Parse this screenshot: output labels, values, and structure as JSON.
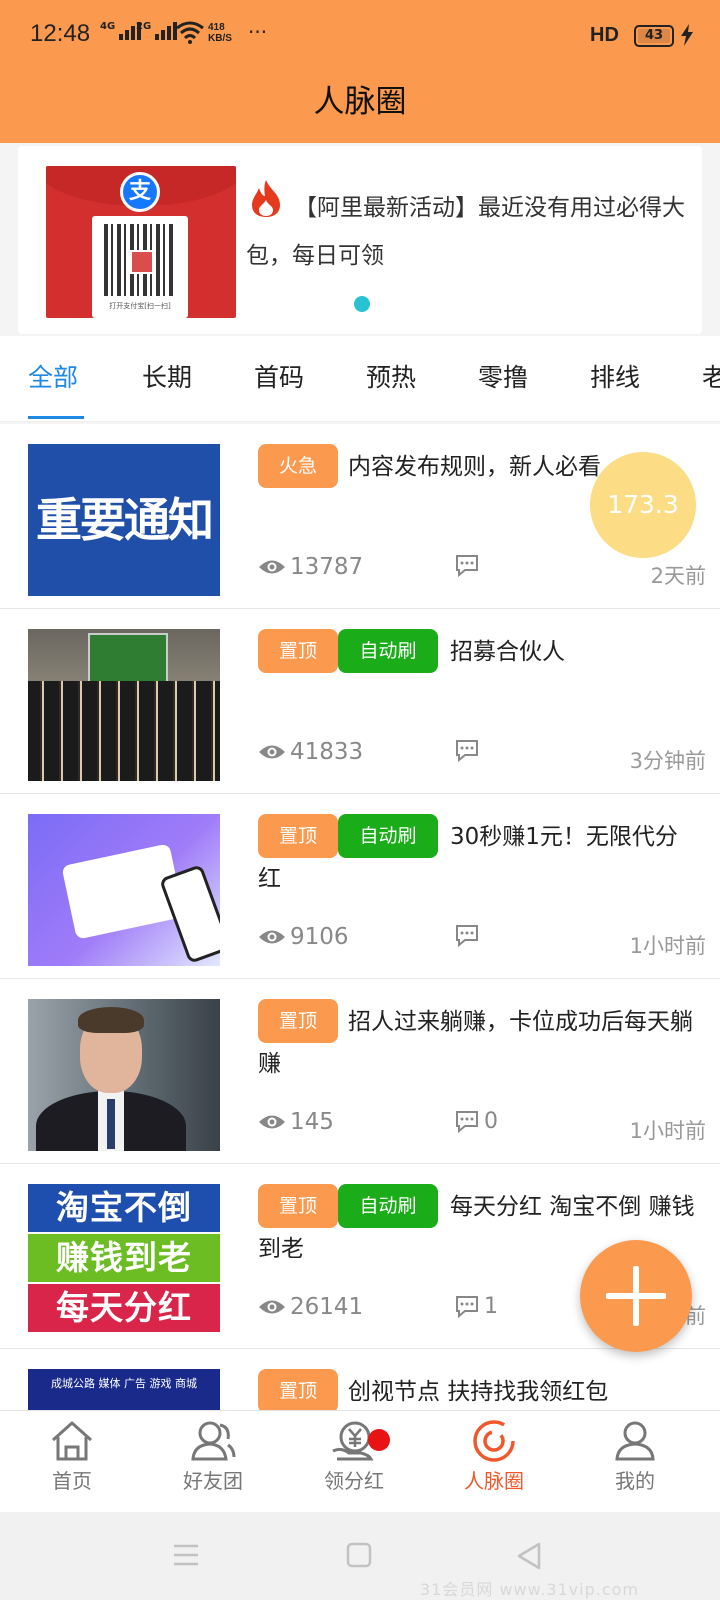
{
  "status_bar": {
    "time": "12:48",
    "signal1": "4G",
    "signal2": "2G",
    "speed_value": "418",
    "speed_unit": "KB/S",
    "more": "···",
    "hd": "HD",
    "battery": "43"
  },
  "header": {
    "title": "人脉圈"
  },
  "banner": {
    "text": "【阿里最新活动】最近没有用过必得大包，每日可领",
    "qr_caption": "打开支付宝[扫一扫]",
    "pay_logo": "支"
  },
  "tabs": [
    {
      "label": "全部",
      "active": true
    },
    {
      "label": "长期"
    },
    {
      "label": "首码"
    },
    {
      "label": "预热"
    },
    {
      "label": "零撸"
    },
    {
      "label": "排线"
    },
    {
      "label": "老"
    }
  ],
  "posts": [
    {
      "thumb_text": "重要通知",
      "badges": [
        "火急"
      ],
      "title": "内容发布规则，新人必看",
      "views": "13787",
      "comments": "",
      "time": "2天前"
    },
    {
      "badges": [
        "置顶",
        "自动刷"
      ],
      "title": "招募合伙人",
      "views": "41833",
      "comments": "",
      "time": "3分钟前"
    },
    {
      "badges": [
        "置顶",
        "自动刷"
      ],
      "title": "30秒赚1元！无限代分红",
      "views": "9106",
      "comments": "",
      "time": "1小时前"
    },
    {
      "badges": [
        "置顶"
      ],
      "title": "招人过来躺赚，卡位成功后每天躺赚",
      "views": "145",
      "comments": "0",
      "time": "1小时前"
    },
    {
      "thumb_lines": [
        "淘宝不倒",
        "赚钱到老",
        "每天分红"
      ],
      "badges": [
        "置顶",
        "自动刷"
      ],
      "title": "每天分红 淘宝不倒 赚钱到老",
      "views": "26141",
      "comments": "1",
      "time": "前"
    },
    {
      "thumb_text": "成城公路 媒体 广告 游戏 商城",
      "badges": [
        "置顶"
      ],
      "title": "创视节点 扶持找我领红包",
      "views": "",
      "comments": "",
      "time": ""
    }
  ],
  "timer_bubble": "173.3",
  "bottom_nav": [
    {
      "label": "首页",
      "icon": "home-icon"
    },
    {
      "label": "好友团",
      "icon": "friends-icon"
    },
    {
      "label": "领分红",
      "icon": "dividend-icon",
      "has_dot": true
    },
    {
      "label": "人脉圈",
      "icon": "circle-icon",
      "active": true
    },
    {
      "label": "我的",
      "icon": "user-icon"
    }
  ],
  "colors": {
    "header": "#fb9a4f",
    "accent_blue": "#1e88e5",
    "badge_orange": "#fb9a4f",
    "badge_green": "#1aad19",
    "nav_active": "#f0572a"
  },
  "watermark": "31会员网 www.31vip.com"
}
